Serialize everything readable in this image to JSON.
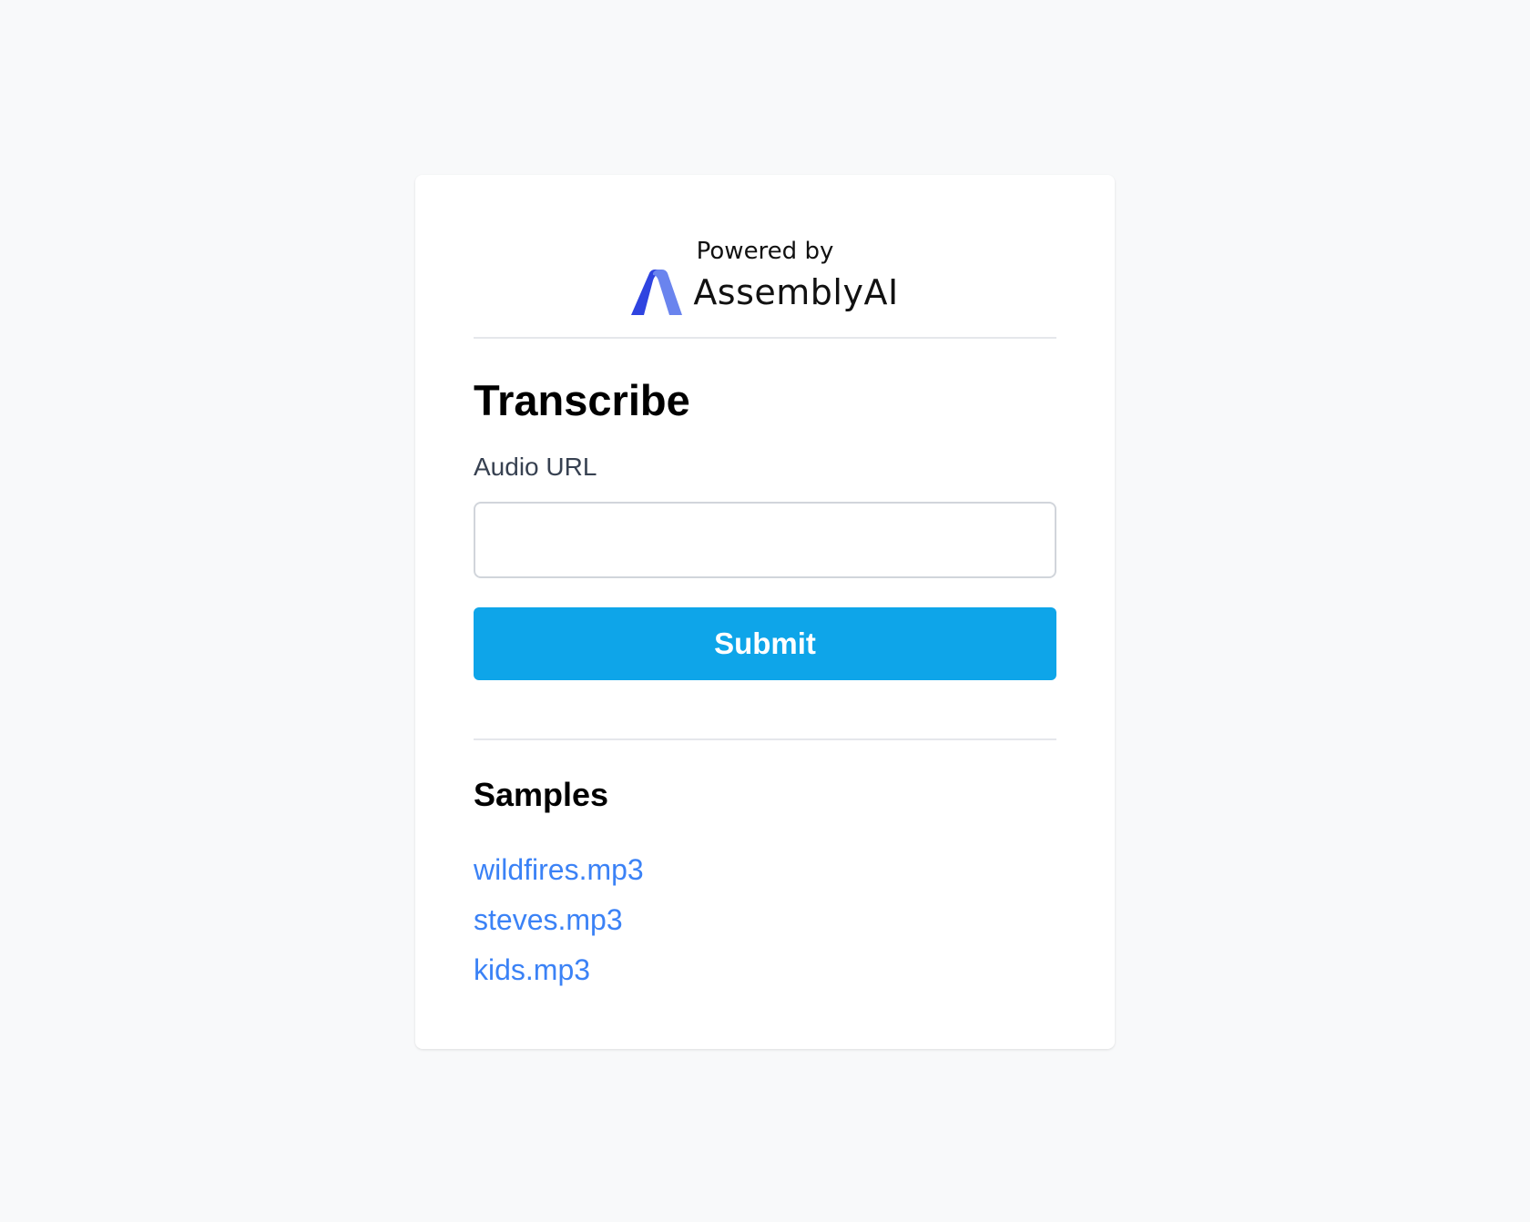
{
  "brand": {
    "powered_by": "Powered by",
    "name": "AssemblyAI",
    "logo_icon": "assemblyai-logo-icon"
  },
  "form": {
    "title": "Transcribe",
    "audio_url_label": "Audio URL",
    "audio_url_value": "",
    "audio_url_placeholder": "",
    "submit_label": "Submit"
  },
  "samples": {
    "title": "Samples",
    "items": [
      {
        "label": "wildfires.mp3"
      },
      {
        "label": "steves.mp3"
      },
      {
        "label": "kids.mp3"
      }
    ]
  },
  "colors": {
    "page_background": "#f8f9fa",
    "card_background": "#ffffff",
    "button_background": "#0ea5e9",
    "link": "#3b82f6",
    "logo_blue": "#2f44e0",
    "logo_light_blue": "#6a84ee"
  }
}
